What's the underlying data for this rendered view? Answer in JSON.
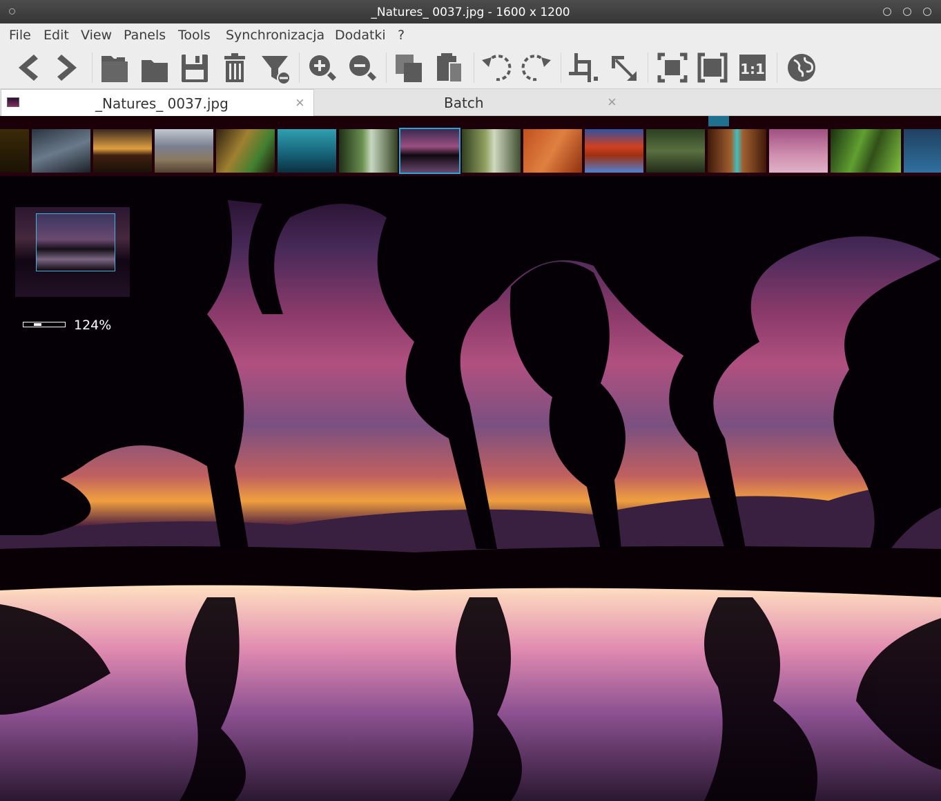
{
  "window": {
    "title": "_Natures_ 0037.jpg  - 1600 x 1200"
  },
  "menu": {
    "items": [
      {
        "label": "File"
      },
      {
        "label": "Edit"
      },
      {
        "label": "View"
      },
      {
        "label": "Panels"
      },
      {
        "label": "Tools"
      },
      {
        "label": "Synchronizacja"
      },
      {
        "label": "Dodatki"
      },
      {
        "label": "?"
      }
    ]
  },
  "toolbar": {
    "icons": [
      "previous-icon",
      "next-icon",
      "open-file-icon",
      "open-folder-icon",
      "save-icon",
      "delete-icon",
      "filter-remove-icon",
      "zoom-in-icon",
      "zoom-out-icon",
      "copy-icon",
      "paste-icon",
      "rotate-left-icon",
      "rotate-right-icon",
      "crop-icon",
      "resize-icon",
      "fit-window-icon",
      "fit-screen-icon",
      "actual-size-icon",
      "web-icon"
    ],
    "actual_size_label": "1:1"
  },
  "tabs": [
    {
      "label": "_Natures_ 0037.jpg",
      "close": "×",
      "active": true
    },
    {
      "label": "Batch",
      "close": "×",
      "active": false
    }
  ],
  "filmstrip": {
    "thumbnail_count": 15,
    "selected_index": 7,
    "accent_color": "#2aa4d4"
  },
  "viewer": {
    "zoom_label": "124%",
    "zoom_fraction": 0.3
  }
}
